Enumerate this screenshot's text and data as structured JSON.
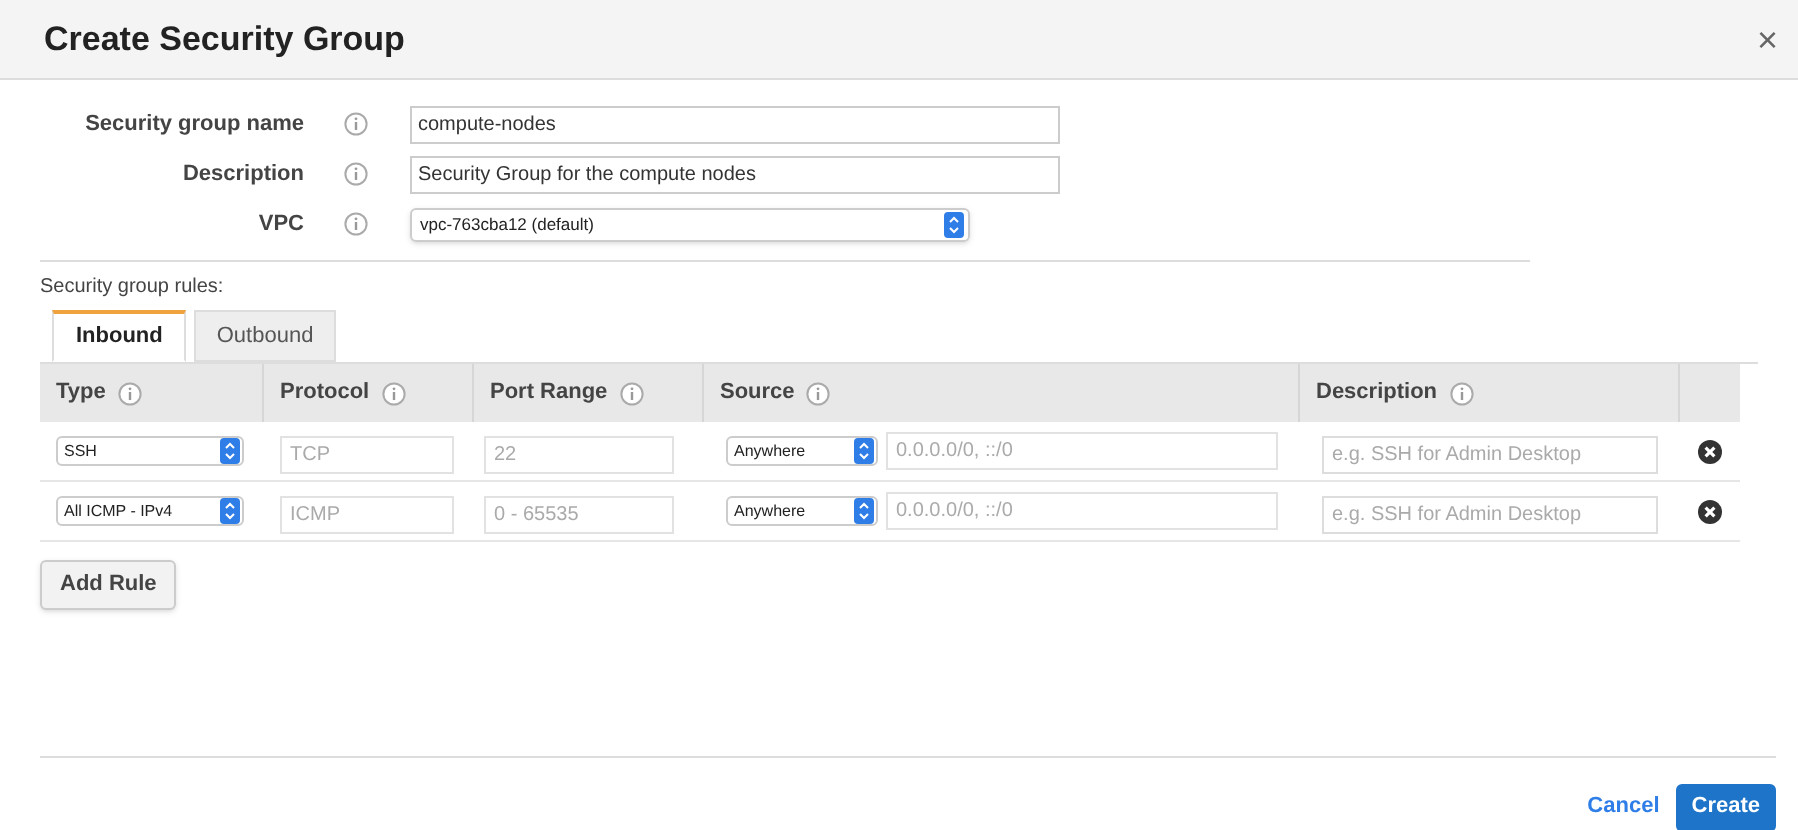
{
  "dialog": {
    "title": "Create Security Group",
    "close": "×"
  },
  "fields": [
    {
      "label": "Security group name",
      "kind": "input",
      "value": "compute-nodes"
    },
    {
      "label": "Description",
      "kind": "input",
      "value": "Security Group for the compute nodes"
    },
    {
      "label": "VPC",
      "kind": "select",
      "value": "vpc-763cba12 (default)"
    }
  ],
  "rules_label": "Security group rules:",
  "tabs": [
    {
      "label": "Inbound",
      "selected": true
    },
    {
      "label": "Outbound",
      "selected": false
    }
  ],
  "table": {
    "columns": [
      "Type",
      "Protocol",
      "Port Range",
      "Source",
      "Description"
    ],
    "rows": [
      {
        "type": "SSH",
        "protocol": "TCP",
        "port_range": "22",
        "source": "Anywhere",
        "cidr": "0.0.0.0/0, ::/0",
        "description_placeholder": "e.g. SSH for Admin Desktop"
      },
      {
        "type": "All ICMP - IPv4",
        "protocol": "ICMP",
        "port_range": "0 - 65535",
        "source": "Anywhere",
        "cidr": "0.0.0.0/0, ::/0",
        "description_placeholder": "e.g. SSH for Admin Desktop"
      }
    ]
  },
  "add_rule": "Add Rule",
  "buttons": {
    "cancel": "Cancel",
    "create": "Create"
  }
}
